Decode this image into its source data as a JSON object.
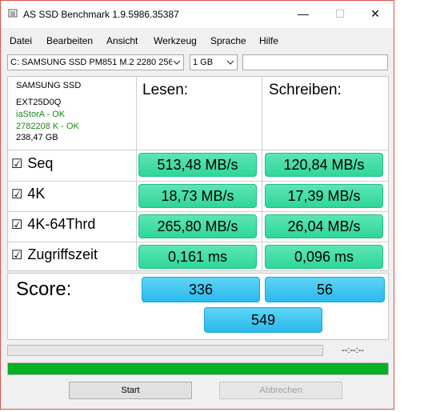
{
  "window": {
    "title": "AS SSD Benchmark 1.9.5986.35387",
    "minimize_glyph": "—",
    "maximize_glyph": "☐",
    "close_glyph": "✕"
  },
  "menu": [
    "Datei",
    "Bearbeiten",
    "Ansicht",
    "Werkzeug",
    "Sprache",
    "Hilfe"
  ],
  "controls": {
    "drive": "C: SAMSUNG SSD PM851 M.2 2280 256",
    "size": "1 GB",
    "text_value": ""
  },
  "drive_info": {
    "model": "SAMSUNG SSD",
    "firmware": "EXT25D0Q",
    "driver": "iaStorA - OK",
    "alignment": "2782208 K - OK",
    "capacity": "238,47 GB"
  },
  "headers": {
    "read": "Lesen:",
    "write": "Schreiben:"
  },
  "check_glyph": "☑",
  "tests": [
    {
      "label": "Seq",
      "read": "513,48 MB/s",
      "write": "120,84 MB/s"
    },
    {
      "label": "4K",
      "read": "18,73 MB/s",
      "write": "17,39 MB/s"
    },
    {
      "label": "4K-64Thrd",
      "read": "265,80 MB/s",
      "write": "26,04 MB/s"
    },
    {
      "label": "Zugriffszeit",
      "read": "0,161 ms",
      "write": "0,096 ms"
    }
  ],
  "score": {
    "label": "Score:",
    "read": "336",
    "write": "56",
    "total": "549"
  },
  "progress": {
    "timer": "--:--:--",
    "overall_fraction": 1.0
  },
  "buttons": {
    "start": "Start",
    "abort": "Abbrechen"
  },
  "colors": {
    "result_green": "#2fd699",
    "score_blue": "#2bb9ec",
    "progress_green": "#06b025",
    "driver_ok_green": "#1a8a1a"
  }
}
